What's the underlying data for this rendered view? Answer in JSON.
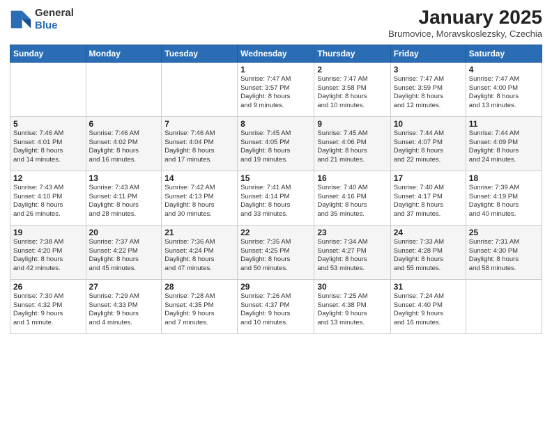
{
  "header": {
    "logo_general": "General",
    "logo_blue": "Blue",
    "month_year": "January 2025",
    "location": "Brumovice, Moravskoslezsky, Czechia"
  },
  "days_of_week": [
    "Sunday",
    "Monday",
    "Tuesday",
    "Wednesday",
    "Thursday",
    "Friday",
    "Saturday"
  ],
  "weeks": [
    [
      {
        "day": "",
        "info": ""
      },
      {
        "day": "",
        "info": ""
      },
      {
        "day": "",
        "info": ""
      },
      {
        "day": "1",
        "info": "Sunrise: 7:47 AM\nSunset: 3:57 PM\nDaylight: 8 hours\nand 9 minutes."
      },
      {
        "day": "2",
        "info": "Sunrise: 7:47 AM\nSunset: 3:58 PM\nDaylight: 8 hours\nand 10 minutes."
      },
      {
        "day": "3",
        "info": "Sunrise: 7:47 AM\nSunset: 3:59 PM\nDaylight: 8 hours\nand 12 minutes."
      },
      {
        "day": "4",
        "info": "Sunrise: 7:47 AM\nSunset: 4:00 PM\nDaylight: 8 hours\nand 13 minutes."
      }
    ],
    [
      {
        "day": "5",
        "info": "Sunrise: 7:46 AM\nSunset: 4:01 PM\nDaylight: 8 hours\nand 14 minutes."
      },
      {
        "day": "6",
        "info": "Sunrise: 7:46 AM\nSunset: 4:02 PM\nDaylight: 8 hours\nand 16 minutes."
      },
      {
        "day": "7",
        "info": "Sunrise: 7:46 AM\nSunset: 4:04 PM\nDaylight: 8 hours\nand 17 minutes."
      },
      {
        "day": "8",
        "info": "Sunrise: 7:45 AM\nSunset: 4:05 PM\nDaylight: 8 hours\nand 19 minutes."
      },
      {
        "day": "9",
        "info": "Sunrise: 7:45 AM\nSunset: 4:06 PM\nDaylight: 8 hours\nand 21 minutes."
      },
      {
        "day": "10",
        "info": "Sunrise: 7:44 AM\nSunset: 4:07 PM\nDaylight: 8 hours\nand 22 minutes."
      },
      {
        "day": "11",
        "info": "Sunrise: 7:44 AM\nSunset: 4:09 PM\nDaylight: 8 hours\nand 24 minutes."
      }
    ],
    [
      {
        "day": "12",
        "info": "Sunrise: 7:43 AM\nSunset: 4:10 PM\nDaylight: 8 hours\nand 26 minutes."
      },
      {
        "day": "13",
        "info": "Sunrise: 7:43 AM\nSunset: 4:11 PM\nDaylight: 8 hours\nand 28 minutes."
      },
      {
        "day": "14",
        "info": "Sunrise: 7:42 AM\nSunset: 4:13 PM\nDaylight: 8 hours\nand 30 minutes."
      },
      {
        "day": "15",
        "info": "Sunrise: 7:41 AM\nSunset: 4:14 PM\nDaylight: 8 hours\nand 33 minutes."
      },
      {
        "day": "16",
        "info": "Sunrise: 7:40 AM\nSunset: 4:16 PM\nDaylight: 8 hours\nand 35 minutes."
      },
      {
        "day": "17",
        "info": "Sunrise: 7:40 AM\nSunset: 4:17 PM\nDaylight: 8 hours\nand 37 minutes."
      },
      {
        "day": "18",
        "info": "Sunrise: 7:39 AM\nSunset: 4:19 PM\nDaylight: 8 hours\nand 40 minutes."
      }
    ],
    [
      {
        "day": "19",
        "info": "Sunrise: 7:38 AM\nSunset: 4:20 PM\nDaylight: 8 hours\nand 42 minutes."
      },
      {
        "day": "20",
        "info": "Sunrise: 7:37 AM\nSunset: 4:22 PM\nDaylight: 8 hours\nand 45 minutes."
      },
      {
        "day": "21",
        "info": "Sunrise: 7:36 AM\nSunset: 4:24 PM\nDaylight: 8 hours\nand 47 minutes."
      },
      {
        "day": "22",
        "info": "Sunrise: 7:35 AM\nSunset: 4:25 PM\nDaylight: 8 hours\nand 50 minutes."
      },
      {
        "day": "23",
        "info": "Sunrise: 7:34 AM\nSunset: 4:27 PM\nDaylight: 8 hours\nand 53 minutes."
      },
      {
        "day": "24",
        "info": "Sunrise: 7:33 AM\nSunset: 4:28 PM\nDaylight: 8 hours\nand 55 minutes."
      },
      {
        "day": "25",
        "info": "Sunrise: 7:31 AM\nSunset: 4:30 PM\nDaylight: 8 hours\nand 58 minutes."
      }
    ],
    [
      {
        "day": "26",
        "info": "Sunrise: 7:30 AM\nSunset: 4:32 PM\nDaylight: 9 hours\nand 1 minute."
      },
      {
        "day": "27",
        "info": "Sunrise: 7:29 AM\nSunset: 4:33 PM\nDaylight: 9 hours\nand 4 minutes."
      },
      {
        "day": "28",
        "info": "Sunrise: 7:28 AM\nSunset: 4:35 PM\nDaylight: 9 hours\nand 7 minutes."
      },
      {
        "day": "29",
        "info": "Sunrise: 7:26 AM\nSunset: 4:37 PM\nDaylight: 9 hours\nand 10 minutes."
      },
      {
        "day": "30",
        "info": "Sunrise: 7:25 AM\nSunset: 4:38 PM\nDaylight: 9 hours\nand 13 minutes."
      },
      {
        "day": "31",
        "info": "Sunrise: 7:24 AM\nSunset: 4:40 PM\nDaylight: 9 hours\nand 16 minutes."
      },
      {
        "day": "",
        "info": ""
      }
    ]
  ]
}
